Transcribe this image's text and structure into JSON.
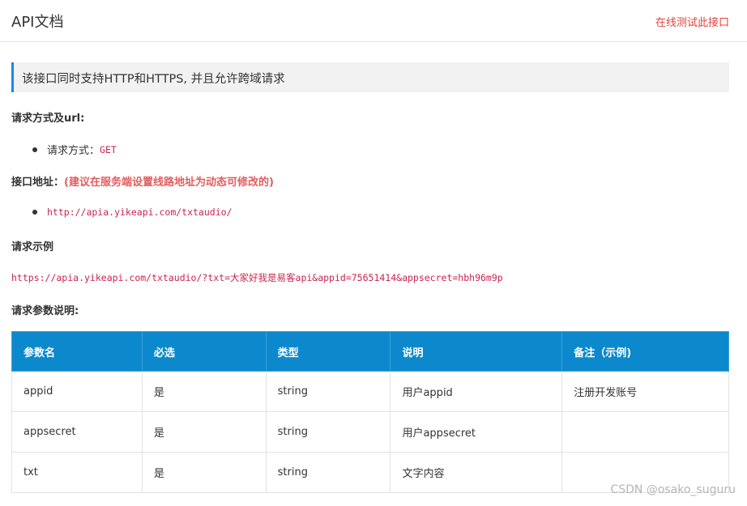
{
  "header": {
    "title": "API文档",
    "test_link": "在线测试此接口"
  },
  "notice": "该接口同时支持HTTP和HTTPS, 并且允许跨域请求",
  "method_section": {
    "title": "请求方式及url:",
    "label": "请求方式：",
    "value": "GET"
  },
  "address_section": {
    "title": "接口地址：",
    "hint": "(建议在服务端设置线路地址为动态可修改的)",
    "url": "http://apia.yikeapi.com/txtaudio/"
  },
  "example_section": {
    "title": "请求示例",
    "url": "https://apia.yikeapi.com/txtaudio/?txt=大家好我是易客api&appid=75651414&appsecret=hbh96m9p"
  },
  "params_section": {
    "title": "请求参数说明:"
  },
  "table": {
    "headers": [
      "参数名",
      "必选",
      "类型",
      "说明",
      "备注（示例)"
    ],
    "rows": [
      [
        "appid",
        "是",
        "string",
        "用户appid",
        "注册开发账号"
      ],
      [
        "appsecret",
        "是",
        "string",
        "用户appsecret",
        ""
      ],
      [
        "txt",
        "是",
        "string",
        "文字内容",
        ""
      ]
    ]
  },
  "watermark": "CSDN @osako_suguru",
  "colors": {
    "accent_blue": "#0c89cc",
    "notice_border": "#1e88e5",
    "link_red": "#e0433d",
    "code_pink": "#c7254e"
  }
}
